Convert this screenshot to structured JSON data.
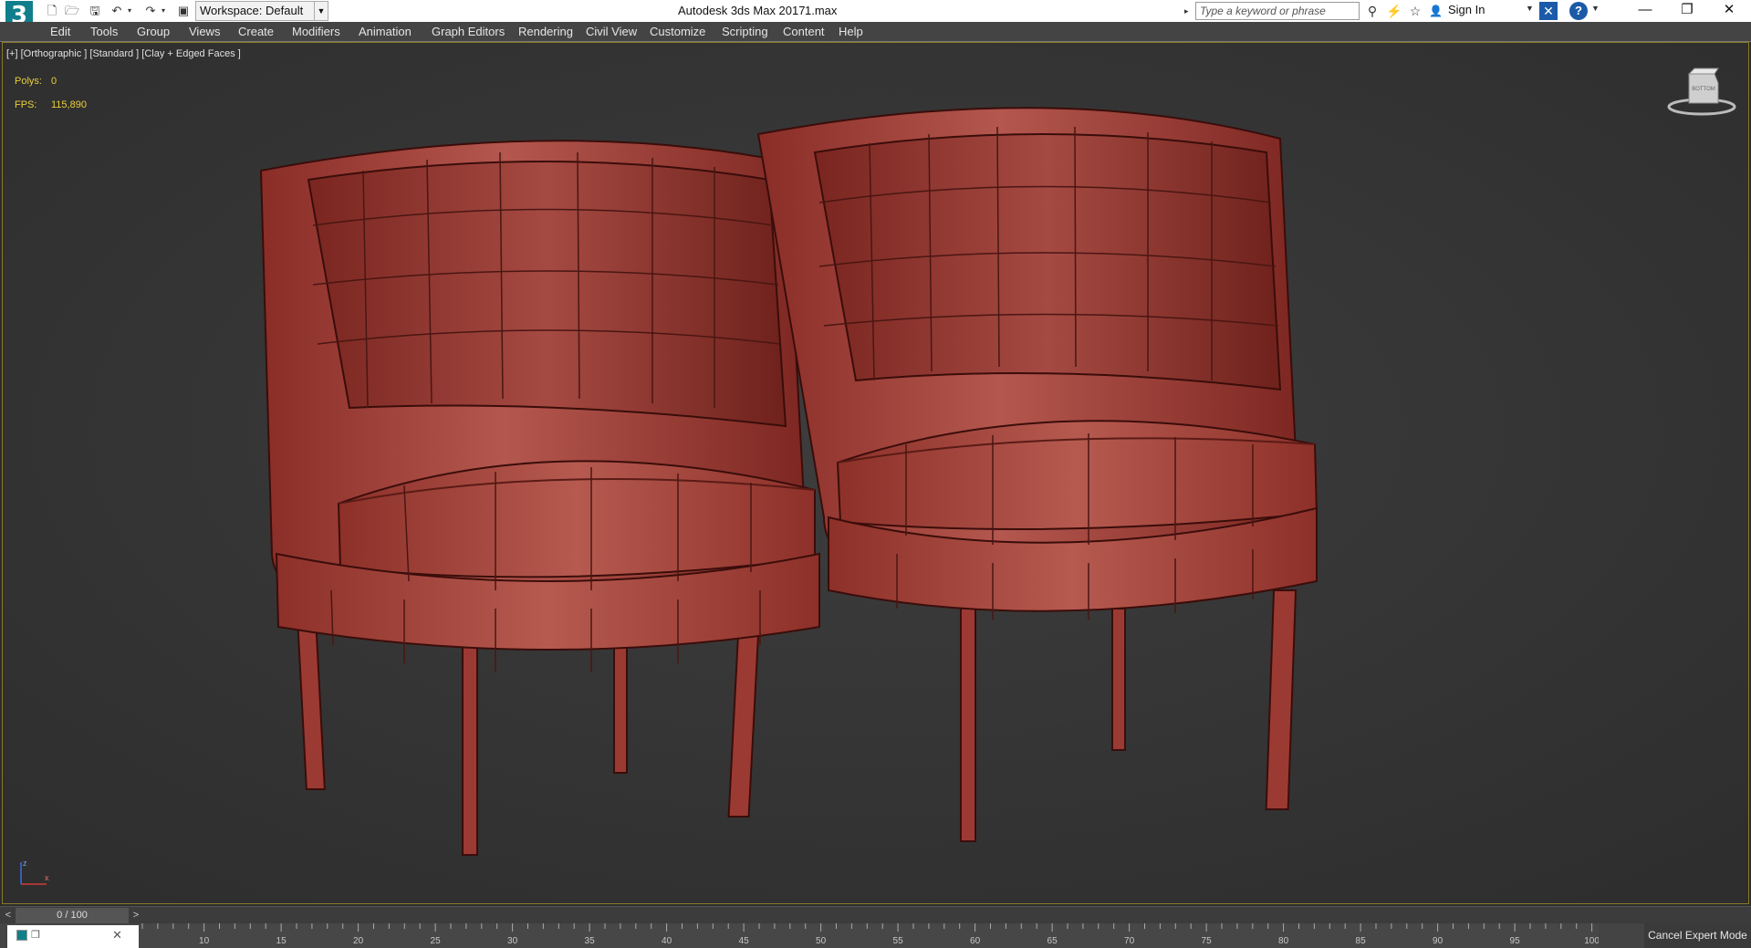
{
  "titlebar": {
    "logo": "3",
    "workspace": "Workspace: Default",
    "app_title": "Autodesk 3ds Max 2017",
    "file_name": "1.max",
    "search_placeholder": "Type a keyword or phrase",
    "signin": "Sign In"
  },
  "menu": [
    {
      "label": "Edit"
    },
    {
      "label": "Tools"
    },
    {
      "label": "Group"
    },
    {
      "label": "Views"
    },
    {
      "label": "Create"
    },
    {
      "label": "Modifiers"
    },
    {
      "label": "Animation"
    },
    {
      "label": "Graph Editors"
    },
    {
      "label": "Rendering"
    },
    {
      "label": "Civil View"
    },
    {
      "label": "Customize"
    },
    {
      "label": "Scripting"
    },
    {
      "label": "Content"
    },
    {
      "label": "Help"
    }
  ],
  "viewport": {
    "label": "[+] [Orthographic ] [Standard ] [Clay + Edged Faces ]",
    "polys_label": "Polys:",
    "polys_value": "0",
    "fps_label": "FPS:",
    "fps_value": "115,890",
    "viewcube_face": "BOTTOM",
    "axis_z": "z",
    "axis_x": "x"
  },
  "timeslider": {
    "position": "0 / 100",
    "prev": "<",
    "next": ">"
  },
  "ruler": {
    "labels": [
      "10",
      "15",
      "20",
      "25",
      "30",
      "35",
      "40",
      "45",
      "50",
      "55",
      "60",
      "65",
      "70",
      "75",
      "80",
      "85",
      "90",
      "95",
      "100"
    ]
  },
  "status": {
    "expert_button": "Cancel Expert Mode"
  },
  "colors": {
    "model": "#a8443c",
    "viewport_bg": "#363636",
    "stats": "#e8cf3a",
    "app_accent": "#117f8b"
  }
}
